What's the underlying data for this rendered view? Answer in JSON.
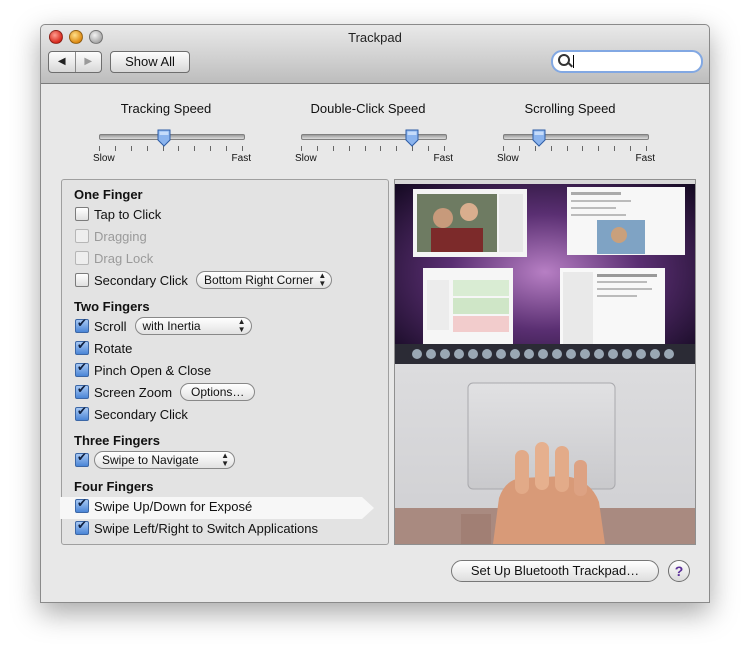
{
  "window": {
    "title": "Trackpad"
  },
  "toolbar": {
    "back": "◀",
    "forward": "▶",
    "show_all": "Show All",
    "search_placeholder": ""
  },
  "sliders": [
    {
      "label": "Tracking Speed",
      "min_label": "Slow",
      "max_label": "Fast",
      "value": 0.45
    },
    {
      "label": "Double-Click Speed",
      "min_label": "Slow",
      "max_label": "Fast",
      "value": 0.77
    },
    {
      "label": "Scrolling Speed",
      "min_label": "Slow",
      "max_label": "Fast",
      "value": 0.25
    }
  ],
  "sections": {
    "one_finger": {
      "title": "One Finger",
      "tap_to_click": "Tap to Click",
      "dragging": "Dragging",
      "drag_lock": "Drag Lock",
      "secondary_click": "Secondary Click",
      "secondary_click_option": "Bottom Right Corner"
    },
    "two_fingers": {
      "title": "Two Fingers",
      "scroll": "Scroll",
      "scroll_option": "with Inertia",
      "rotate": "Rotate",
      "pinch": "Pinch Open & Close",
      "screen_zoom": "Screen Zoom",
      "options_button": "Options…",
      "secondary_click": "Secondary Click"
    },
    "three_fingers": {
      "title": "Three Fingers",
      "swipe_option": "Swipe to Navigate"
    },
    "four_fingers": {
      "title": "Four Fingers",
      "swipe_updown": "Swipe Up/Down for Exposé",
      "swipe_leftright": "Swipe Left/Right to Switch Applications"
    }
  },
  "footer": {
    "setup_button": "Set Up Bluetooth Trackpad…",
    "help": "?"
  },
  "colors": {
    "accent": "#4a85d6",
    "window_bg": "#e8e8e8"
  }
}
